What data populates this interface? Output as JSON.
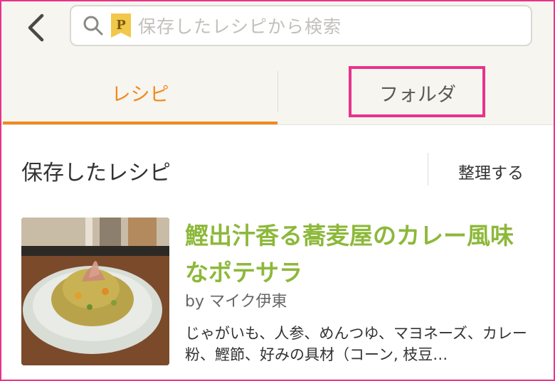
{
  "header": {
    "search": {
      "placeholder": "保存したレシピから検索"
    },
    "tabs": [
      {
        "label": "レシピ",
        "active": true
      },
      {
        "label": "フォルダ",
        "active": false
      }
    ]
  },
  "section": {
    "title": "保存したレシピ",
    "action": "整理する"
  },
  "recipe": {
    "title": "鰹出汁香る蕎麦屋のカレー風味なポテサラ",
    "author": "by マイク伊東",
    "ingredients": "じゃがいも、人参、めんつゆ、マヨネーズ、カレー粉、鰹節、好みの具材（コーン, 枝豆…"
  },
  "colors": {
    "accent": "#f08a1d",
    "title_green": "#8db83a",
    "highlight": "#e8338a"
  },
  "icons": [
    "back-chevron-icon",
    "search-icon",
    "premium-p-badge-icon"
  ]
}
